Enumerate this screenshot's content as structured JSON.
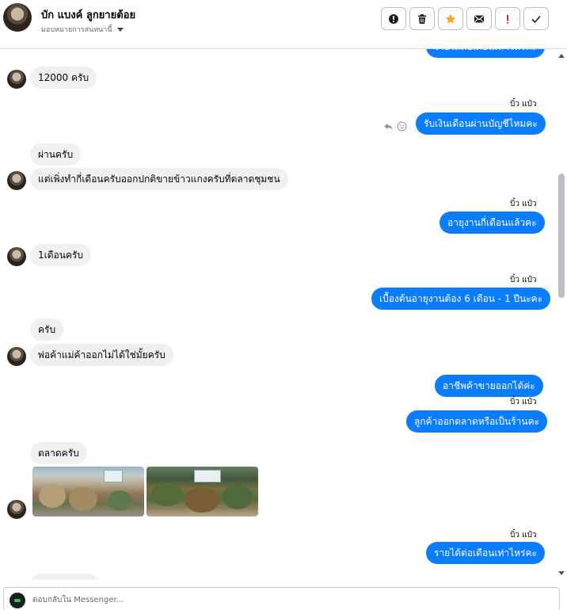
{
  "header": {
    "contact_name": "บัก แบงค์ ลูกยายต้อย",
    "assign_label": "มอบหมายการสนทนานี้",
    "actions": [
      {
        "name": "follow-up-button",
        "icon": "exclamation-circle-icon"
      },
      {
        "name": "delete-button",
        "icon": "trash-icon"
      },
      {
        "name": "star-button",
        "icon": "star-icon",
        "color": "#f5a623"
      },
      {
        "name": "mark-unread-button",
        "icon": "envelope-icon"
      },
      {
        "name": "mark-spam-button",
        "icon": "exclamation-icon",
        "color": "#e41e3f"
      },
      {
        "name": "mark-done-button",
        "icon": "check-icon"
      }
    ]
  },
  "colors": {
    "outgoing_bubble": "#0a7cff",
    "incoming_bubble": "#f0f0f0",
    "star": "#f5a623",
    "spam": "#e41e3f"
  },
  "thread": {
    "top_cut_message": "รายได้ต่อเดือนเท่าไหร่คะ",
    "messages": [
      {
        "from": "customer",
        "text": "12000 ครับ"
      },
      {
        "from": "page",
        "sender": "บิ๋ว แป๋ว",
        "text": "รับเงินเดือนผ่านบัญชีไหมคะ"
      },
      {
        "from": "customer",
        "text": "ผ่านครับ"
      },
      {
        "from": "customer",
        "text": "แต่เพิ่งทำกี่เดือนครับออกปกติขายข้าวแกงครับที่ตลาดชุมชน"
      },
      {
        "from": "page",
        "sender": "บิ๋ว แป๋ว",
        "text": "อายุงานกี่เดือนแล้วคะ"
      },
      {
        "from": "customer",
        "text": "1เดือนครับ"
      },
      {
        "from": "page",
        "sender": "บิ๋ว แป๋ว",
        "text": "เบื้องต้นอายุงานต้อง 6 เดือน - 1 ปีนะคะ"
      },
      {
        "from": "customer",
        "text": "ครับ"
      },
      {
        "from": "customer",
        "text": "พ่อค้าแม่ค้าออกไม่ได้ใช่มั้ยครับ"
      },
      {
        "from": "page",
        "text": "อาชีพค้าขายออกได้ค่ะ"
      },
      {
        "from": "page",
        "sender": "บิ๋ว แป๋ว",
        "text": "ลูกค้าออกตลาดหรือเป็นร้านคะ"
      },
      {
        "from": "customer",
        "text": "ตลาดครับ"
      },
      {
        "from": "customer",
        "photos": [
          "market-photo-1",
          "market-photo-2"
        ]
      },
      {
        "from": "page",
        "sender": "บิ๋ว แป๋ว",
        "text": "รายได้ต่อเดือนเท่าไหร่คะ"
      }
    ]
  },
  "composer": {
    "placeholder": "ตอบกลับใน Messenger..."
  }
}
